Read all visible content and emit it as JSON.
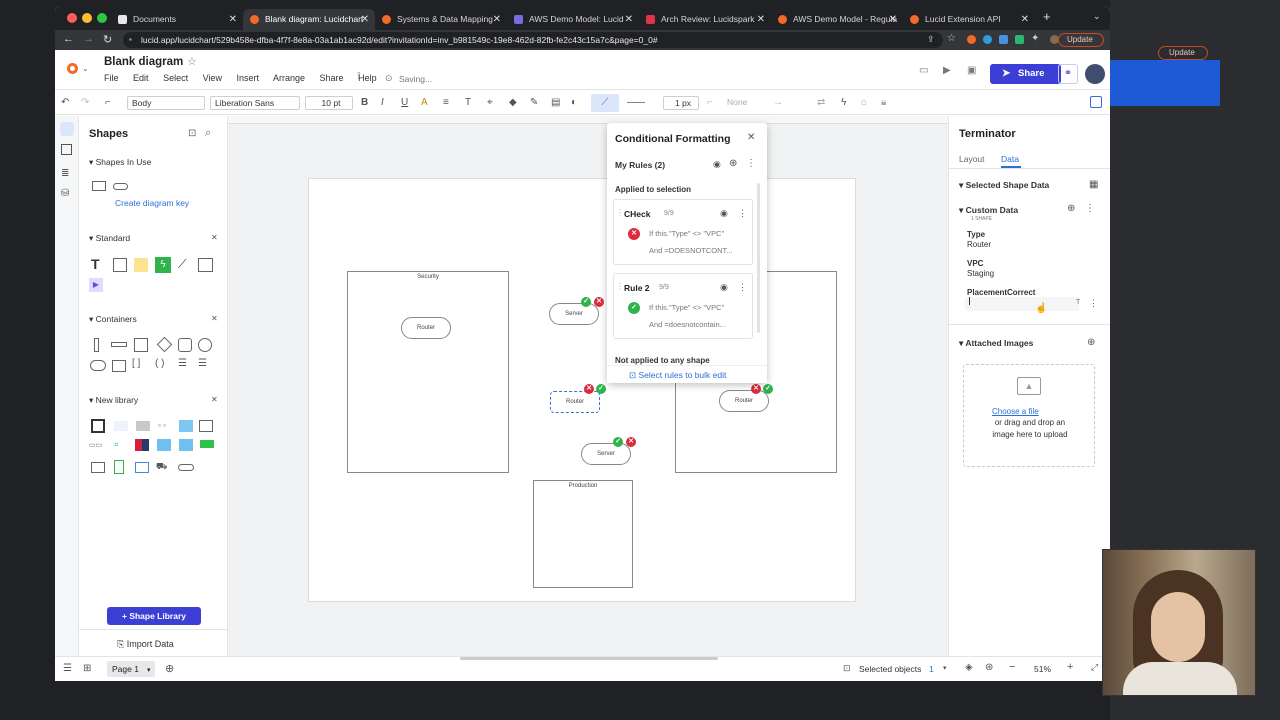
{
  "browser": {
    "tabs": [
      {
        "label": "Documents",
        "active": false
      },
      {
        "label": "Blank diagram: Lucidchart",
        "active": true
      },
      {
        "label": "Systems & Data Mapping",
        "active": false
      },
      {
        "label": "AWS Demo Model: Lucid",
        "active": false
      },
      {
        "label": "Arch Review: Lucidspark",
        "active": false
      },
      {
        "label": "AWS Demo Model - Regula",
        "active": false
      },
      {
        "label": "Lucid Extension API",
        "active": false
      }
    ],
    "url": "lucid.app/lucidchart/529b458e-dfba-4f7f-8e8a-03a1ab1ac92d/edit?invitationId=inv_b981549c-19e8-462d-82fb-fe2c43c15a7c&page=0_0#",
    "update_label": "Update"
  },
  "app": {
    "doc_title": "Blank diagram",
    "menus": [
      "File",
      "Edit",
      "Select",
      "View",
      "Insert",
      "Arrange",
      "Share",
      "Help"
    ],
    "saving_label": "Saving...",
    "share_label": "Share"
  },
  "toolbar": {
    "style_select": "Body",
    "font_select": "Liberation Sans",
    "font_size": "10 pt",
    "line_width": "1 px",
    "arrow_none": "None"
  },
  "shapes_panel": {
    "title": "Shapes",
    "shapes_in_use": "Shapes In Use",
    "create_key": "Create diagram key",
    "standard": "Standard",
    "containers": "Containers",
    "new_library": "New library",
    "shape_library_button": "Shape Library",
    "import_data": "Import Data"
  },
  "diagram": {
    "security_title": "Security",
    "production_title": "Production",
    "router1": "Router",
    "server1": "Server",
    "router2": "Router",
    "server2": "Server",
    "router3": "Router"
  },
  "cf_panel": {
    "title": "Conditional Formatting",
    "my_rules": "My Rules (2)",
    "applied": "Applied to selection",
    "rules": [
      {
        "name": "CHeck",
        "count": "9/9",
        "line1": "If this.\"Type\" <> \"VPC\"",
        "line2": "And =DOESNOTCONT..."
      },
      {
        "name": "Rule 2",
        "count": "9/9",
        "line1": "If this.\"Type\" <> \"VPC\"",
        "line2": "And =doesnotcontain..."
      }
    ],
    "not_applied": "Not applied to any shape",
    "bulk_edit": "Select rules to bulk edit"
  },
  "right_panel": {
    "title": "Terminator",
    "tab_layout": "Layout",
    "tab_data": "Data",
    "selected_shape_data": "Selected Shape Data",
    "custom_data": "Custom Data",
    "custom_data_sub": "1 SHAPE",
    "fields": [
      {
        "label": "Type",
        "value": "Router"
      },
      {
        "label": "VPC",
        "value": "Staging"
      },
      {
        "label": "PlacementCorrect",
        "value": ""
      }
    ],
    "attached_images": "Attached Images",
    "choose_file": "Choose a file",
    "upload_text": "or drag and drop an image here to upload"
  },
  "bottom": {
    "page_label": "Page 1",
    "selected_objects": "Selected objects",
    "selected_count": "1",
    "zoom": "51%"
  },
  "colors": {
    "accent": "#3b3fd6",
    "ok": "#2fb34b",
    "error": "#dd2b3b"
  }
}
